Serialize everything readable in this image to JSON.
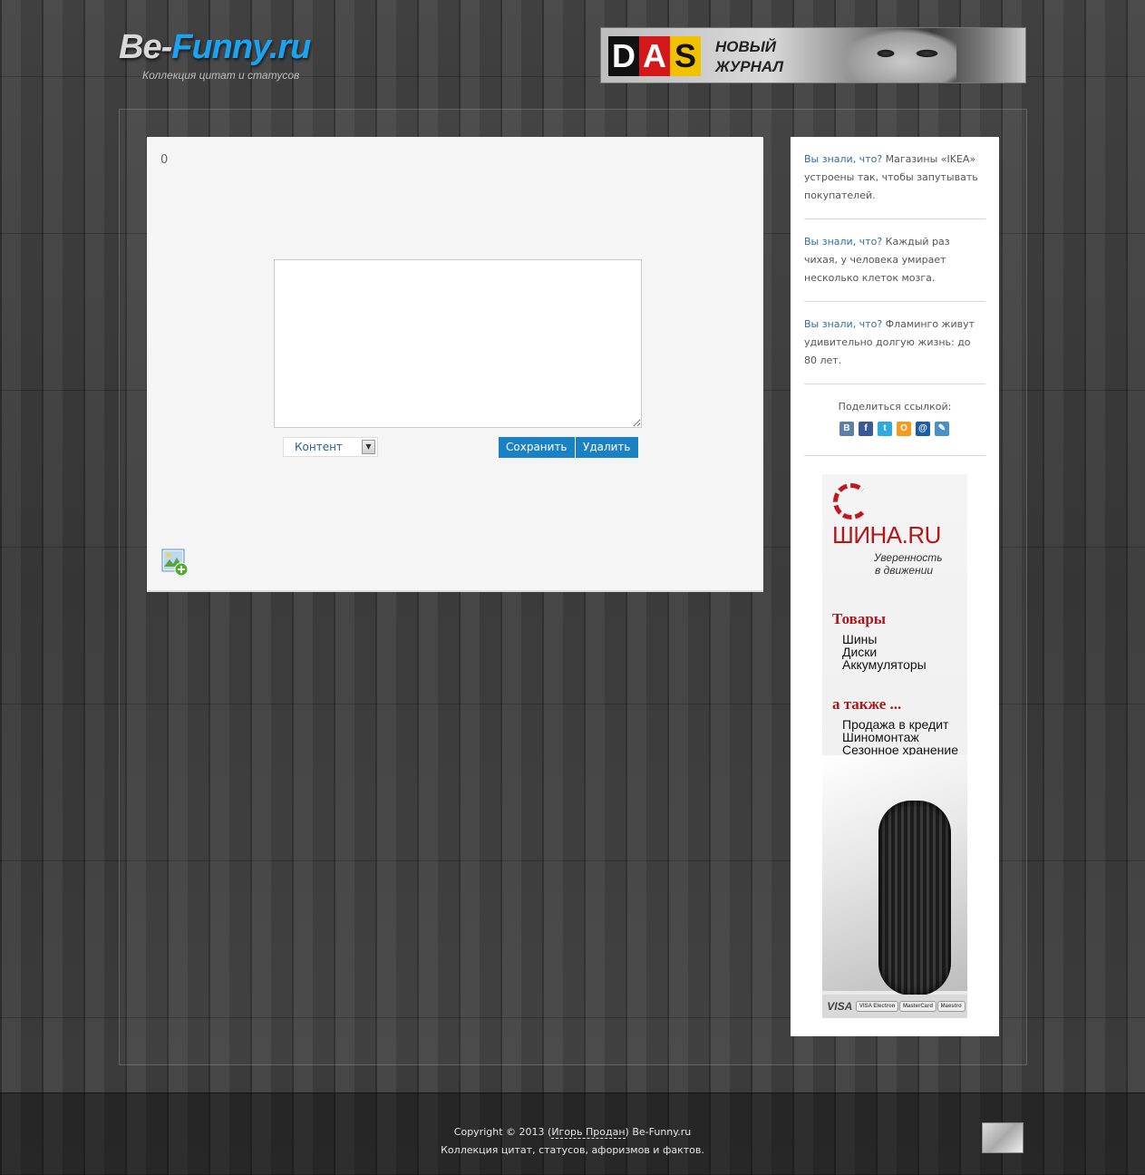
{
  "header": {
    "logo_part1": "Be-",
    "logo_part2": "Funny.ru",
    "logo_tagline": "Коллекция цитат и статусов",
    "banner": {
      "letters": [
        "D",
        "A",
        "S"
      ],
      "text_line1": "НОВЫЙ",
      "text_line2": "ЖУРНАЛ"
    }
  },
  "content": {
    "counter": "0",
    "textarea_value": "",
    "select_value": "Контент",
    "save_label": "Сохранить",
    "delete_label": "Удалить",
    "add_image_icon": "add-image-icon"
  },
  "sidebar": {
    "facts": [
      {
        "question": "Вы знали, что?",
        "text": "Магазины «IKEA» устроены так, чтобы запутывать покупателей."
      },
      {
        "question": "Вы знали, что?",
        "text": "Каждый раз чихая, у человека умирает несколько клеток мозга."
      },
      {
        "question": "Вы знали, что?",
        "text": "Фламинго живут удивительно долгую жизнь: до 80 лет."
      }
    ],
    "share_label": "Поделиться ссылкой:",
    "share_icons": [
      {
        "name": "vkontakte-icon",
        "glyph": "B",
        "color": "#5b7fa6"
      },
      {
        "name": "facebook-icon",
        "glyph": "f",
        "color": "#3b5998"
      },
      {
        "name": "twitter-icon",
        "glyph": "t",
        "color": "#2fa9e0"
      },
      {
        "name": "odnoklassniki-icon",
        "glyph": "O",
        "color": "#f59a1d"
      },
      {
        "name": "mailru-icon",
        "glyph": "@",
        "color": "#1d5ca6"
      },
      {
        "name": "livejournal-icon",
        "glyph": "✎",
        "color": "#4a90c8"
      }
    ],
    "ad": {
      "brand": "ШИНА.RU",
      "slogan_line1": "Уверенность",
      "slogan_line2": "в движении",
      "goods_heading": "Товары",
      "goods": [
        "Шины",
        "Диски",
        "Аккумуляторы"
      ],
      "also_heading": "а также ...",
      "also": [
        "Продажа в кредит",
        "Шиномонтаж",
        "Сезонное хранение"
      ],
      "payments": [
        "VISA",
        "VISA Electron",
        "MasterCard",
        "Maestro"
      ]
    }
  },
  "footer": {
    "copyright_prefix": "Copyright © 2013 (",
    "author": "Игорь Продан",
    "copyright_suffix": ") Be-Funny.ru",
    "tagline": "Коллекция цитат, статусов, афоризмов и фактов."
  },
  "colors": {
    "accent_blue": "#1a82c4",
    "logo_blue": "#1aa3f0",
    "fact_question": "#2f6f9f",
    "shina_red": "#b5161b"
  }
}
